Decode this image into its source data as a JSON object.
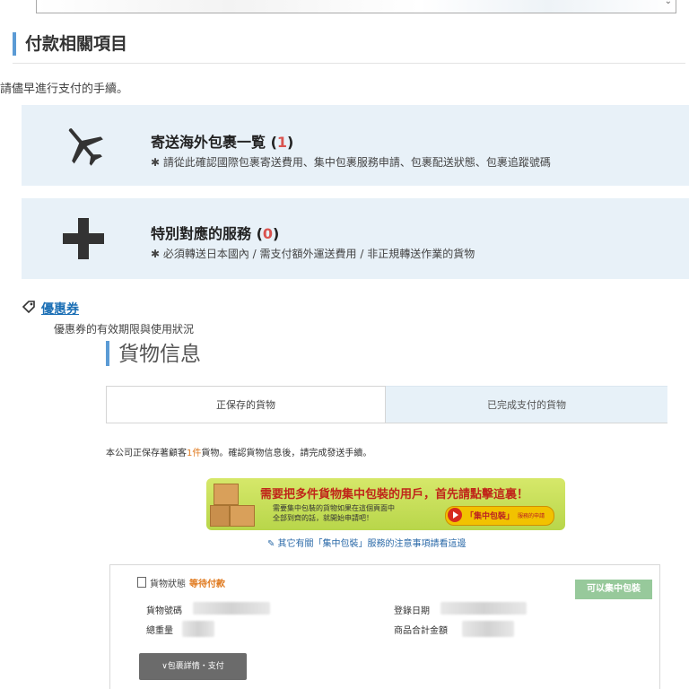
{
  "section": {
    "title": "付款相關項目",
    "intro": "請儘早進行支付的手續。"
  },
  "cards": [
    {
      "title": "寄送海外包裹一覧",
      "count": "1",
      "desc": "✱ 請從此確認國際包裹寄送費用、集中包裹服務申請、包裹配送狀態、包裹追蹤號碼",
      "icon": "airplane-icon"
    },
    {
      "title": "特別對應的服務",
      "count": "0",
      "desc": "✱ 必須轉送日本國內 / 需支付額外運送費用 / 非正規轉送作業的貨物",
      "icon": "plus-icon"
    }
  ],
  "coupon": {
    "link": "優惠券",
    "desc": "優惠券的有效期限與使用狀況",
    "icon": "tag-icon"
  },
  "cargo": {
    "title": "貨物信息",
    "tabs": [
      "正保存的貨物",
      "已完成支付的貨物"
    ],
    "notice_before": "本公司正保存著顧客",
    "notice_count": "1件",
    "notice_after": "貨物。確認貨物信息後，請完成發送手續。"
  },
  "banner": {
    "title": "需要把多件貨物集中包裝的用戶，首先請點擊這裏！",
    "sub1": "需要集中包裝的貨物如果在這個頁面中",
    "sub2": "全部到齊的話，就開始申請吧！",
    "button": "「集中包裝」",
    "button_sub": "服務的申請"
  },
  "link_note": "✎ 其它有關「集中包裝」服務的注意事項請看這邊",
  "panel": {
    "status_label": "貨物狀態",
    "status_value": "等待付款",
    "badge": "可以集中包裝",
    "labels": {
      "number": "貨物號碼",
      "weight": "總重量",
      "date": "登錄日期",
      "total": "商品合計金額"
    },
    "button": "∨包裹詳情・支付"
  },
  "colors": {
    "accent": "#5b9bd5",
    "card_bg": "#e8f1f8",
    "count_red": "#d9534f",
    "badge_green": "#97c99b",
    "status_orange": "#e07a1f"
  }
}
